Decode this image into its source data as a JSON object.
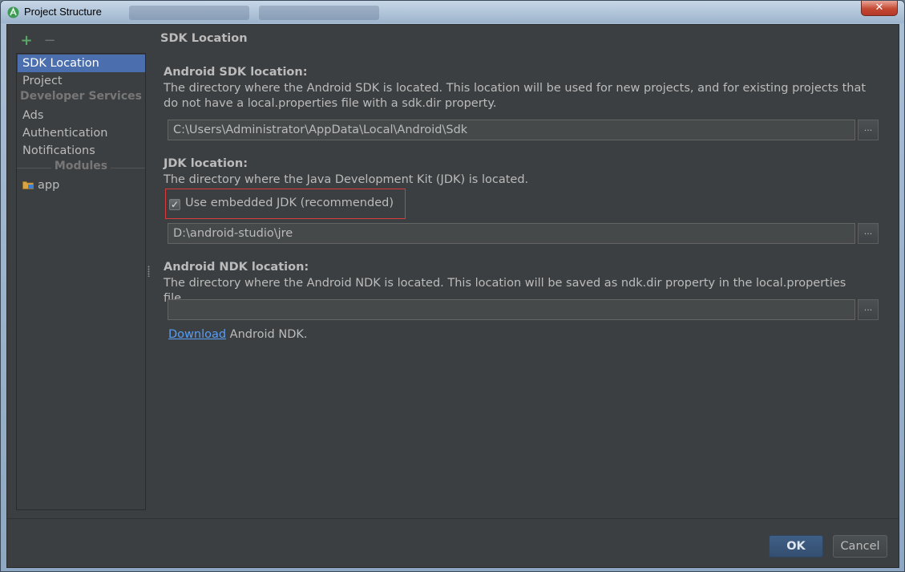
{
  "window": {
    "title": "Project Structure",
    "close_glyph": "✕",
    "icon": "android-studio-icon"
  },
  "sidebar": {
    "add_glyph": "+",
    "remove_glyph": "−",
    "items": [
      {
        "label": "SDK Location"
      },
      {
        "label": "Project"
      },
      {
        "label": "Ads"
      },
      {
        "label": "Authentication"
      },
      {
        "label": "Notifications"
      }
    ],
    "sections": [
      "Developer Services",
      "Modules"
    ],
    "modules": [
      {
        "label": "app",
        "icon": "module-folder-icon"
      }
    ]
  },
  "main": {
    "title": "SDK Location",
    "sdk": {
      "heading": "Android SDK location:",
      "description": "The directory where the Android SDK is located. This location will be used for new projects, and for existing projects that do not have a local.properties file with a sdk.dir property.",
      "path": "C:\\Users\\Administrator\\AppData\\Local\\Android\\Sdk",
      "browse_label": "..."
    },
    "jdk": {
      "heading": "JDK location:",
      "description": "The directory where the Java Development Kit (JDK) is located.",
      "checkbox_label": "Use embedded JDK (recommended)",
      "checkbox_checked": true,
      "checkbox_glyph": "✓",
      "path": "D:\\android-studio\\jre",
      "browse_label": "..."
    },
    "ndk": {
      "heading": "Android NDK location:",
      "description": "The directory where the Android NDK is located. This location will be saved as ndk.dir property in the local.properties file.",
      "path": "",
      "browse_label": "...",
      "download_link": "Download",
      "download_rest": " Android NDK."
    }
  },
  "footer": {
    "ok_label": "OK",
    "cancel_label": "Cancel"
  },
  "colors": {
    "background": "#3c3f41",
    "selection": "#4b6eaf",
    "link": "#589df6",
    "highlight_border": "#d93a3a"
  }
}
